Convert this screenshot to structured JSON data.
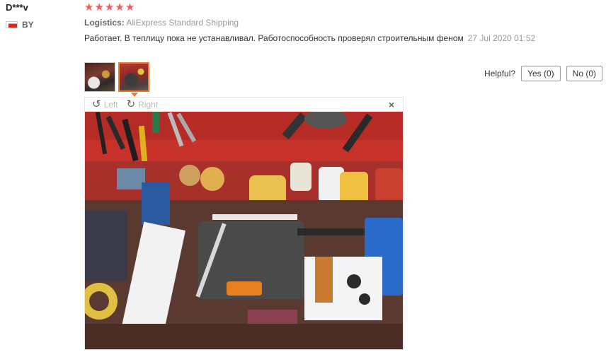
{
  "user": {
    "name": "D***v",
    "country": "BY",
    "flag_icon": "belarus-flag-icon"
  },
  "review": {
    "rating": 5,
    "stars": [
      "★",
      "★",
      "★",
      "★",
      "★"
    ],
    "star_color": "#f35c5c",
    "logistics_label": "Logistics:",
    "logistics_value": "AliExpress Standard Shipping",
    "text": "Работает. В теплицу пока не устанавливал. Работоспособность проверял строительным феном",
    "date": "27 Jul 2020 01:52",
    "thumbnails": [
      {
        "name": "review-photo-thumbnail-1",
        "active": false
      },
      {
        "name": "review-photo-thumbnail-2",
        "active": true
      }
    ]
  },
  "helpful": {
    "label": "Helpful?",
    "yes_label": "Yes (0)",
    "no_label": "No (0)"
  },
  "viewer": {
    "rotate_left_label": "Left",
    "rotate_right_label": "Right",
    "rotate_left_icon": "rotate-left-icon",
    "rotate_right_icon": "rotate-right-icon",
    "close_icon": "close-icon",
    "close_glyph": "×",
    "active_thumb_color": "#f07b2d"
  }
}
